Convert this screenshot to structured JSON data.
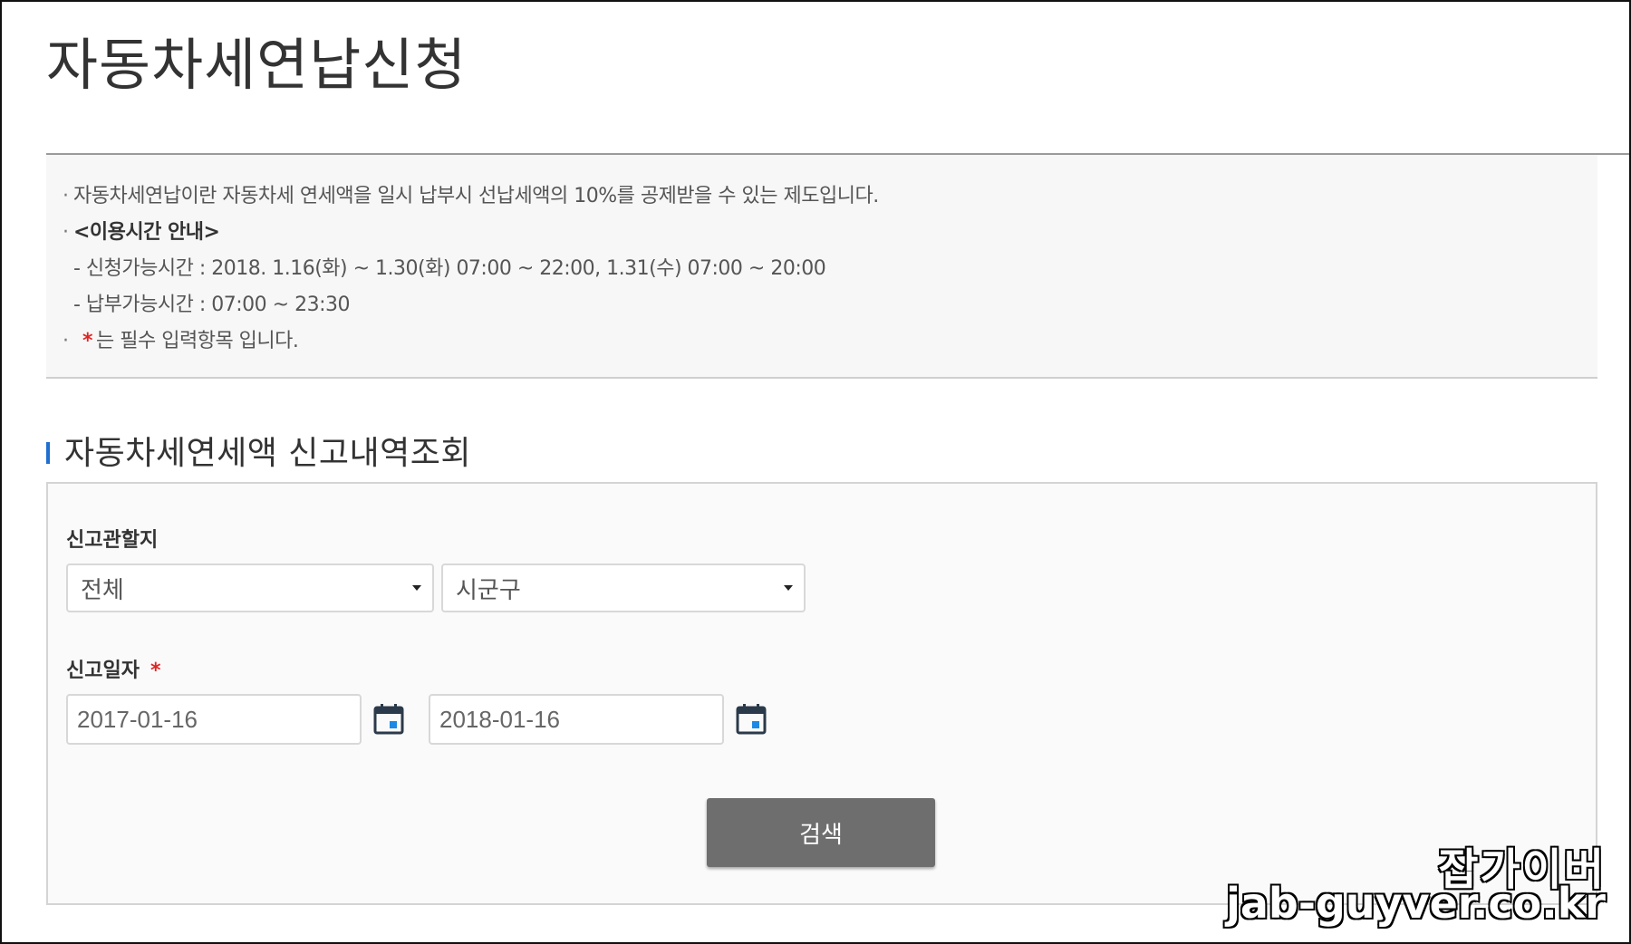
{
  "page": {
    "title": "자동차세연납신청"
  },
  "info": {
    "line1": "자동차세연납이란 자동차세 연세액을 일시 납부시 선납세액의 10%를 공제받을 수 있는 제도입니다.",
    "line2": "<이용시간 안내>",
    "line3": "- 신청가능시간 : 2018. 1.16(화) ~ 1.30(화) 07:00 ~ 22:00, 1.31(수) 07:00 ~ 20:00",
    "line4": "- 납부가능시간 : 07:00 ~ 23:30",
    "required_star": "*",
    "line5": "는 필수 입력항목 입니다."
  },
  "section": {
    "title": "자동차세연세액 신고내역조회"
  },
  "form": {
    "jurisdiction_label": "신고관할지",
    "province_select": "전체",
    "district_select": "시군구",
    "date_label": "신고일자",
    "date_required_star": "*",
    "date_from": "2017-01-16",
    "date_to": "2018-01-16",
    "search_button": "검색"
  },
  "watermark": {
    "korean": "잡가이버",
    "url": "jab-guyver.co.kr"
  },
  "colors": {
    "accent_blue": "#1f6fd1",
    "required_red": "#e02424",
    "button_gray": "#6e6e6e"
  },
  "icons": {
    "select_caret": "caret-down-icon",
    "calendar": "calendar-icon"
  }
}
